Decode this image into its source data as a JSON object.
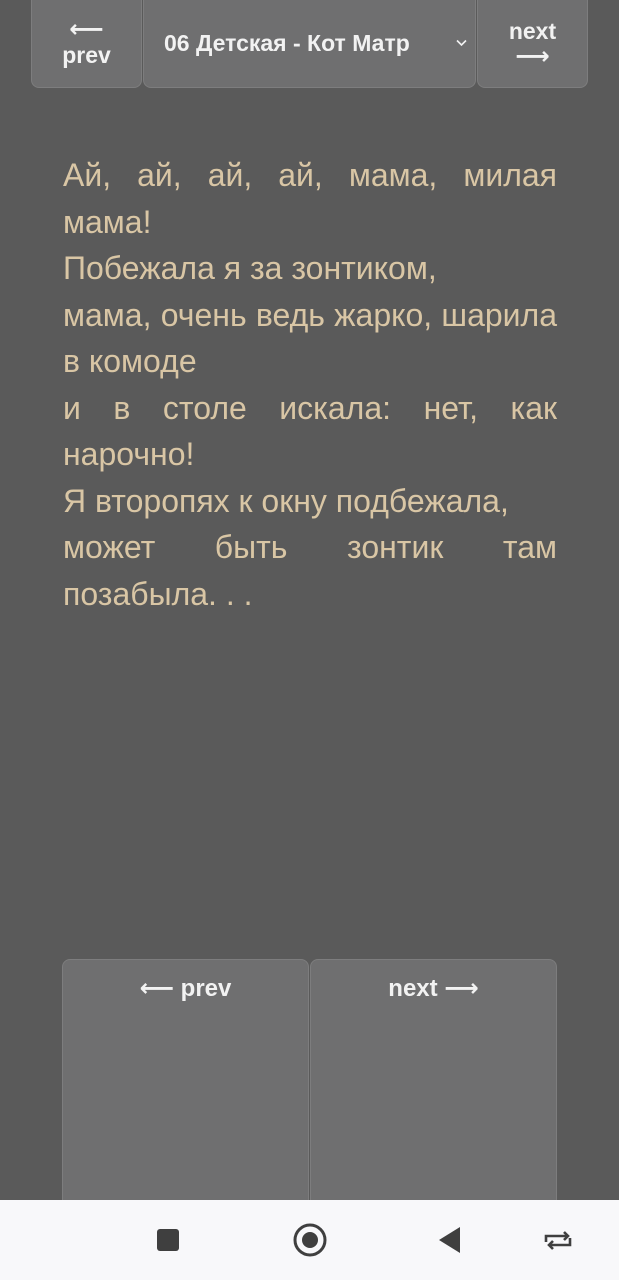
{
  "top_nav": {
    "prev_arrow": "⟵",
    "prev_label": "prev",
    "song_title": "06 Детская - Кот Матр",
    "next_label": "next",
    "next_arrow": "⟶"
  },
  "lyrics": [
    "Ай, ай, ай, ай, мама, милая мама!",
    "Побежала я за зонтиком,",
    "мама, очень ведь жарко, шарила в комоде",
    "и в столе искала: нет, как нарочно!",
    "Я второпях к окну подбежала,",
    "может быть зонтик там позабыла. . ."
  ],
  "bottom_nav": {
    "prev_label": "⟵ prev",
    "next_label": "next ⟶"
  },
  "system_bar": {
    "icons": [
      "stop-square-icon",
      "home-circle-icon",
      "back-triangle-icon",
      "rotate-icon"
    ]
  },
  "colors": {
    "background": "#5a5a5a",
    "button": "#6f6f70",
    "lyrics_text": "#d9c6a5",
    "system_bar": "#f8f8fa"
  }
}
